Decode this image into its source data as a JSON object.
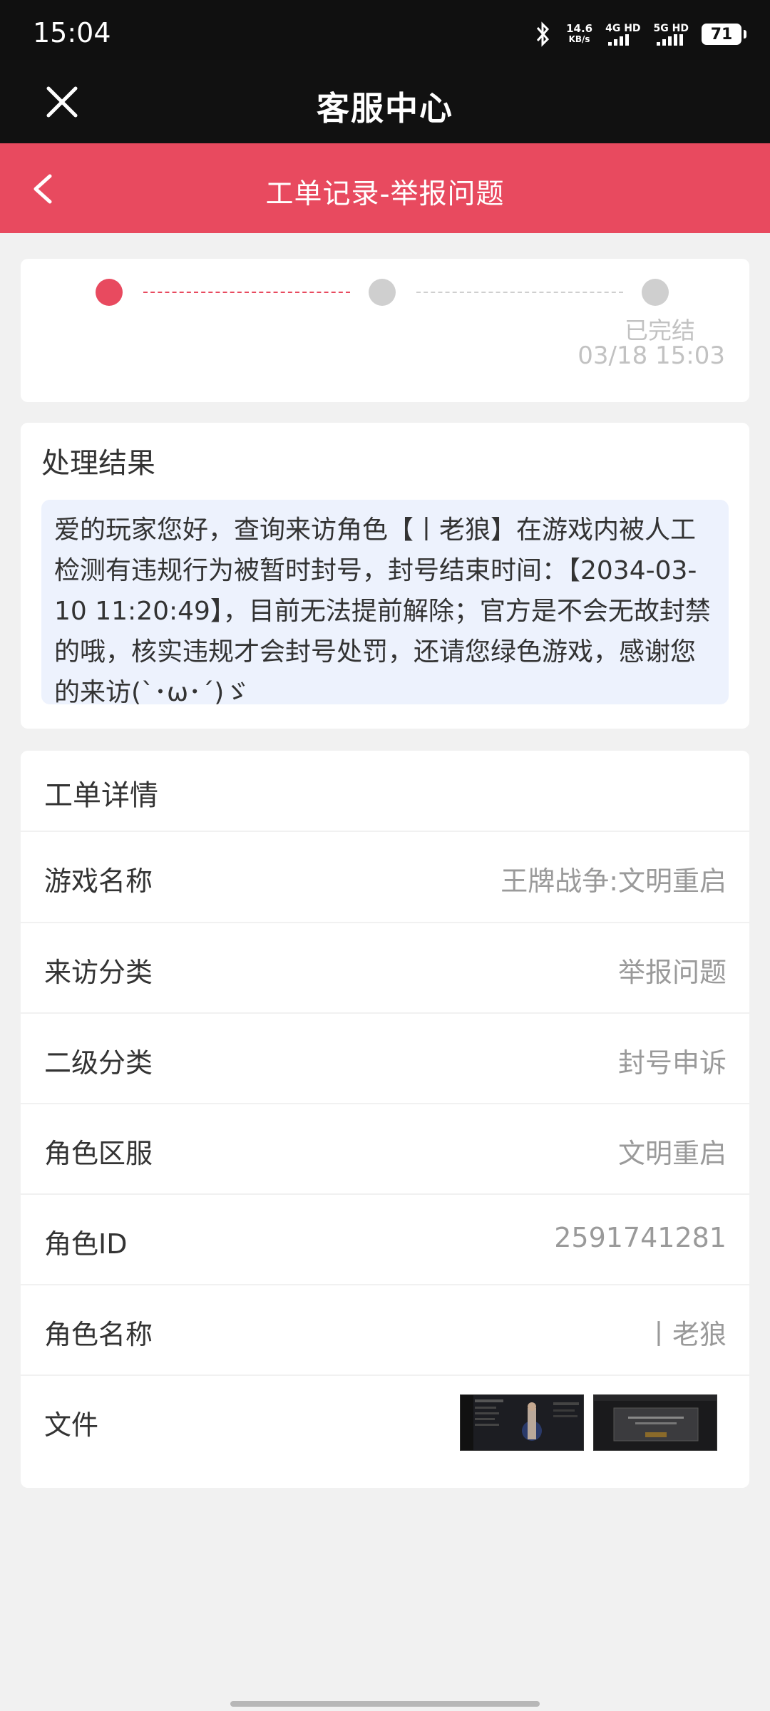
{
  "status_bar": {
    "time": "15:04",
    "speed_value": "14.6",
    "speed_unit": "KB/s",
    "sim1": "4G HD",
    "sim2": "5G HD",
    "battery": "71"
  },
  "app_bar": {
    "title": "客服中心",
    "close_icon": "close-icon"
  },
  "header": {
    "title": "工单记录-举报问题",
    "back_icon": "chevron-left-icon",
    "color": "#e84a5f"
  },
  "progress": {
    "current_step": 1,
    "total_steps": 3,
    "final_label": "已完结",
    "final_time": "03/18 15:03"
  },
  "result": {
    "heading": "处理结果",
    "message": "爱的玩家您好，查询来访角色【丨老狼】在游戏内被人工检测有违规行为被暂时封号，封号结束时间：【2034-03-10 11:20:49】，目前无法提前解除；官方是不会无故封禁的哦，核实违规才会封号处罚，还请您绿色游戏，感谢您的来访(`･ω･´)ゞ"
  },
  "details": {
    "heading": "工单详情",
    "rows": [
      {
        "label": "游戏名称",
        "value": "王牌战争:文明重启"
      },
      {
        "label": "来访分类",
        "value": "举报问题"
      },
      {
        "label": "二级分类",
        "value": "封号申诉"
      },
      {
        "label": "角色区服",
        "value": "文明重启"
      },
      {
        "label": "角色ID",
        "value": "2591741281"
      },
      {
        "label": "角色名称",
        "value": "丨老狼"
      }
    ],
    "files_label": "文件",
    "files": [
      "screenshot-thumbnail",
      "screenshot-thumbnail"
    ]
  }
}
